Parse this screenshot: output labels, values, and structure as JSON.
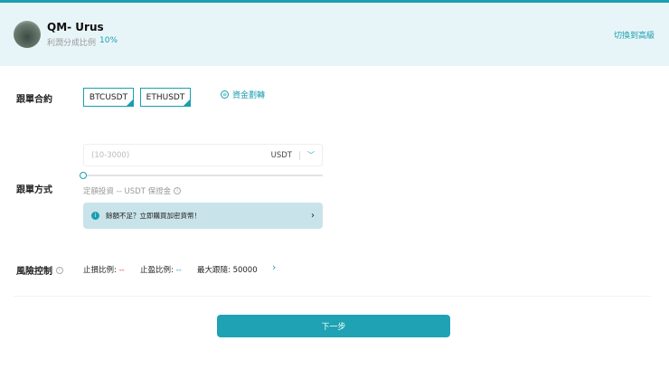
{
  "header": {
    "name": "QM- Urus",
    "ratio_label": "利潤分成比例",
    "ratio_value": "10%",
    "switch_label": "切換到高級"
  },
  "contract": {
    "label": "跟單合約",
    "tags": [
      "BTCUSDT",
      "ETHUSDT"
    ],
    "transfer_label": "資金劃轉"
  },
  "mode": {
    "label": "跟單方式",
    "input_placeholder": "(10-3000)",
    "unit": "USDT",
    "slider_value": 0,
    "hint": "定額投資 -- USDT 保證金",
    "banner": "餘額不足？立即購買加密貨幣！"
  },
  "risk": {
    "label": "風險控制",
    "stop_loss_label": "止損比例:",
    "stop_loss_value": "--",
    "take_profit_label": "止盈比例:",
    "take_profit_value": "--",
    "max_follow_label": "最大跟隨:",
    "max_follow_value": "50000"
  },
  "next_label": "下一步"
}
